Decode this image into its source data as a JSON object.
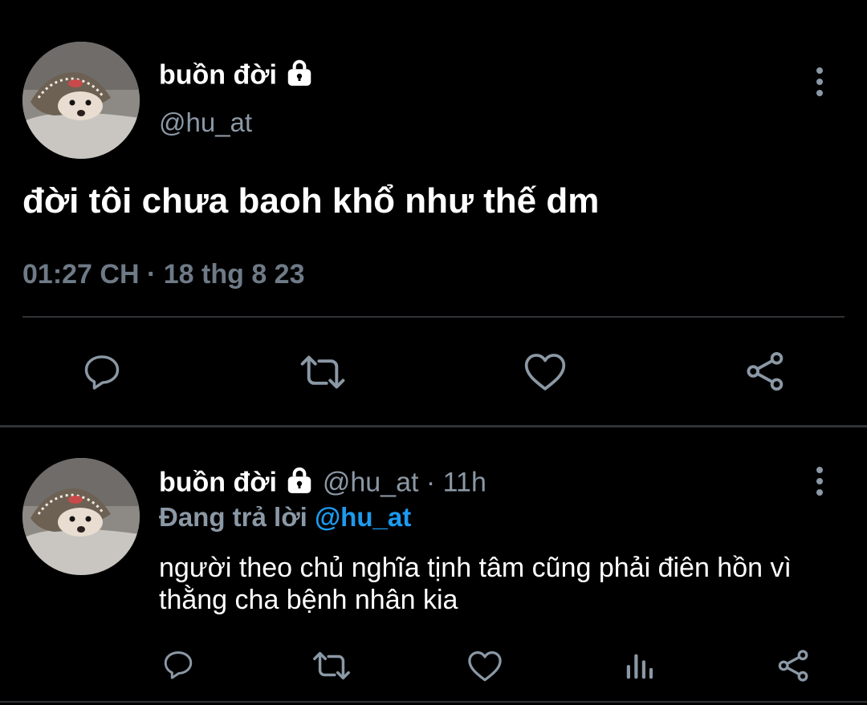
{
  "main_tweet": {
    "display_name": "buồn đời",
    "handle": "@hu_at",
    "text": "đời tôi chưa baoh khổ như thế dm",
    "time": "01:27 CH",
    "separator": "·",
    "date": "18 thg 8 23",
    "icons": {
      "lock": "lock-icon",
      "more": "more-vertical-icon",
      "reply": "reply-icon",
      "retweet": "retweet-icon",
      "like": "heart-icon",
      "share": "share-icon"
    }
  },
  "reply_tweet": {
    "display_name": "buồn đời",
    "handle": "@hu_at",
    "separator": "·",
    "age": "11h",
    "replying_prefix": "Đang trả lời",
    "replying_to": "@hu_at",
    "text": "người theo chủ nghĩa tịnh tâm cũng phải điên hồn vì thằng cha bệnh nhân kia",
    "icons": {
      "lock": "lock-icon",
      "more": "more-vertical-icon",
      "reply": "reply-icon",
      "retweet": "retweet-icon",
      "like": "heart-icon",
      "views": "analytics-icon",
      "share": "share-icon"
    }
  },
  "colors": {
    "background": "#000000",
    "primary_text": "#ffffff",
    "secondary_text": "#8b98a5",
    "icon": "#8b98a5",
    "divider": "#2f3336",
    "link": "#1d9bf0"
  }
}
